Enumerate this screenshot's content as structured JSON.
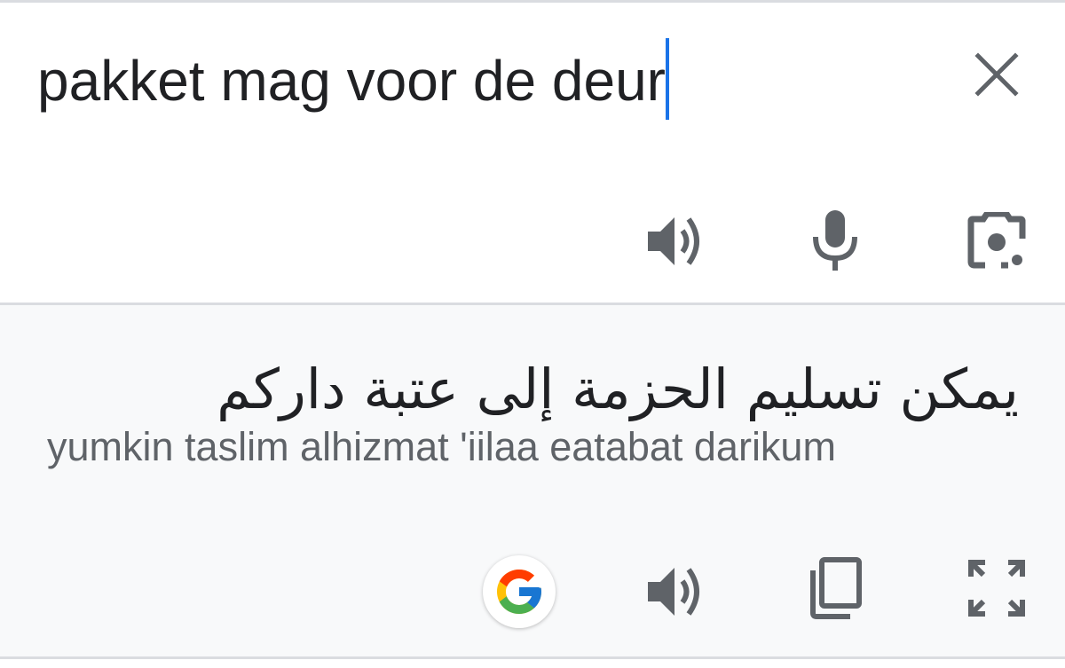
{
  "source": {
    "text": "pakket mag voor de deur",
    "caret_color": "#1a73e8"
  },
  "source_actions": {
    "clear": "close-icon",
    "listen": "volume-icon",
    "voice": "microphone-icon",
    "camera": "camera-lens-icon"
  },
  "result": {
    "translation": "يمكن تسليم الحزمة إلى عتبة داركم",
    "transliteration": "yumkin taslim alhizmat 'iilaa eatabat darikum"
  },
  "result_actions": {
    "google": "google-logo-icon",
    "listen": "volume-icon",
    "copy": "copy-icon",
    "fullscreen": "fullscreen-icon"
  },
  "colors": {
    "icon": "#5f6368",
    "text": "#202124",
    "result_bg": "#f8f9fa",
    "divider": "#dadce0"
  }
}
